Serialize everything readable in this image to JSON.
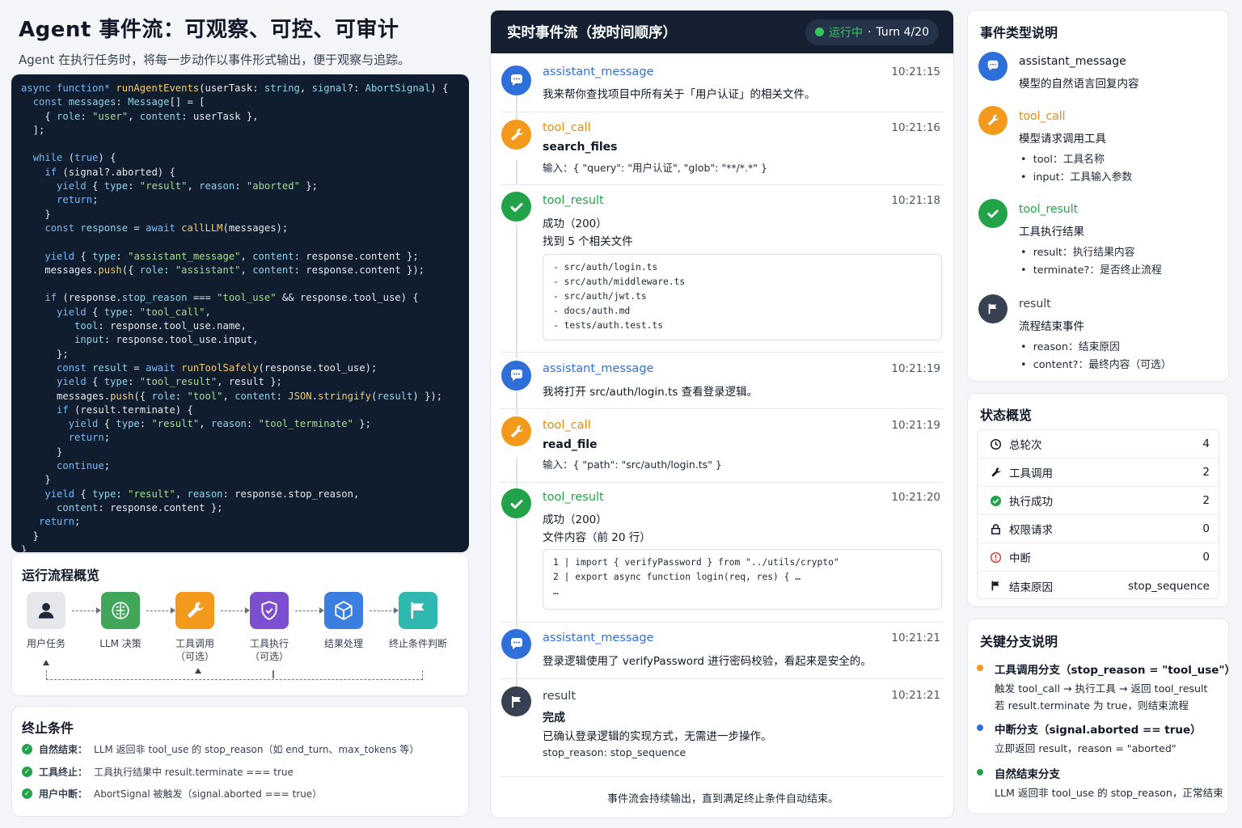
{
  "header": {
    "title": "Agent 事件流：可观察、可控、可审计",
    "subtitle": "Agent 在执行任务时，将每一步动作以事件形式输出，便于观察与追踪。"
  },
  "flow": {
    "title": "运行流程概览",
    "steps": [
      {
        "label": "用户任务",
        "icon": "user-icon",
        "color": "#e5e7eb"
      },
      {
        "label": "LLM 决策",
        "icon": "brain-icon",
        "color": "#3fa65a"
      },
      {
        "label": "工具调用\n（可选）",
        "icon": "wrench-icon",
        "color": "#f39a1c"
      },
      {
        "label": "工具执行\n（可选）",
        "icon": "shield-icon",
        "color": "#7b4fd0"
      },
      {
        "label": "结果处理",
        "icon": "cube-icon",
        "color": "#3a7fe0"
      },
      {
        "label": "终止条件判断",
        "icon": "flag-icon",
        "color": "#2fb7b0"
      }
    ]
  },
  "termination": {
    "title": "终止条件",
    "items": [
      {
        "label": "自然结束：",
        "text": "LLM 返回非 tool_use 的 stop_reason（如 end_turn、max_tokens 等）"
      },
      {
        "label": "工具终止：",
        "text": "工具执行结果中 result.terminate === true"
      },
      {
        "label": "用户中断：",
        "text": "AbortSignal 被触发（signal.aborted === true）"
      }
    ]
  },
  "stream": {
    "title": "实时事件流（按时间顺序）",
    "status": "运行中",
    "turn": "Turn 4/20",
    "footer": "事件流会持续输出，直到满足终止条件自动结束。",
    "events": [
      {
        "type": "assistant_message",
        "time": "10:21:15",
        "text": "我来帮你查找项目中所有关于「用户认证」的相关文件。"
      },
      {
        "type": "tool_call",
        "time": "10:21:16",
        "name": "search_files",
        "input": "输入：{ \"query\": \"用户认证\", \"glob\": \"**/*.*\" }"
      },
      {
        "type": "tool_result",
        "time": "10:21:18",
        "status": "成功（200）",
        "summary": "找到 5 个相关文件",
        "lines": [
          "- src/auth/login.ts",
          "- src/auth/middleware.ts",
          "- src/auth/jwt.ts",
          "- docs/auth.md",
          "- tests/auth.test.ts"
        ]
      },
      {
        "type": "assistant_message",
        "time": "10:21:19",
        "text": "我将打开 src/auth/login.ts 查看登录逻辑。"
      },
      {
        "type": "tool_call",
        "time": "10:21:19",
        "name": "read_file",
        "input": "输入：{ \"path\": \"src/auth/login.ts\" }"
      },
      {
        "type": "tool_result",
        "time": "10:21:20",
        "status": "成功（200）",
        "summary": "文件内容（前 20 行）",
        "lines": [
          "1 | import { verifyPassword } from \"../utils/crypto\"",
          "2 | export async function login(req, res) { …",
          "…"
        ]
      },
      {
        "type": "assistant_message",
        "time": "10:21:21",
        "text": "登录逻辑使用了 verifyPassword 进行密码校验，看起来是安全的。"
      },
      {
        "type": "result",
        "time": "10:21:21",
        "status": "完成",
        "text": "已确认登录逻辑的实现方式，无需进一步操作。",
        "stop": "stop_reason: stop_sequence"
      }
    ]
  },
  "types": {
    "title": "事件类型说明",
    "items": [
      {
        "name": "assistant_message",
        "desc": "模型的自然语言回复内容",
        "bullets": []
      },
      {
        "name": "tool_call",
        "desc": "模型请求调用工具",
        "bullets": [
          "tool：工具名称",
          "input：工具输入参数"
        ]
      },
      {
        "name": "tool_result",
        "desc": "工具执行结果",
        "bullets": [
          "result：执行结果内容",
          "terminate?：是否终止流程"
        ]
      },
      {
        "name": "result",
        "desc": "流程结束事件",
        "bullets": [
          "reason：结束原因",
          "content?：最终内容（可选）"
        ]
      }
    ]
  },
  "status_overview": {
    "title": "状态概览",
    "rows": [
      {
        "label": "总轮次",
        "value": "4",
        "icon": "clock-icon"
      },
      {
        "label": "工具调用",
        "value": "2",
        "icon": "wrench-icon"
      },
      {
        "label": "执行成功",
        "value": "2",
        "icon": "check-icon"
      },
      {
        "label": "权限请求",
        "value": "0",
        "icon": "lock-icon"
      },
      {
        "label": "中断",
        "value": "0",
        "icon": "alert-icon"
      },
      {
        "label": "结束原因",
        "value": "stop_sequence",
        "icon": "flag-icon"
      }
    ]
  },
  "branches": {
    "title": "关键分支说明",
    "items": [
      {
        "title": "工具调用分支（stop_reason = \"tool_use\"）",
        "color": "#f39a1c",
        "lines": [
          "触发 tool_call → 执行工具 → 返回 tool_result",
          "若 result.terminate 为 true，则结束流程"
        ]
      },
      {
        "title": "中断分支（signal.aborted == true）",
        "color": "#2f6fd9",
        "lines": [
          "立即返回 result，reason = \"aborted\""
        ]
      },
      {
        "title": "自然结束分支",
        "color": "#22a34a",
        "lines": [
          "LLM 返回非 tool_use 的 stop_reason，正常结束"
        ]
      }
    ]
  },
  "colors": {
    "assistant": "#2f6fd9",
    "tool_call": "#f39a1c",
    "tool_result": "#22a34a",
    "result": "#374151",
    "header_bg": "#152133",
    "code_bg": "#0f1d2e"
  }
}
